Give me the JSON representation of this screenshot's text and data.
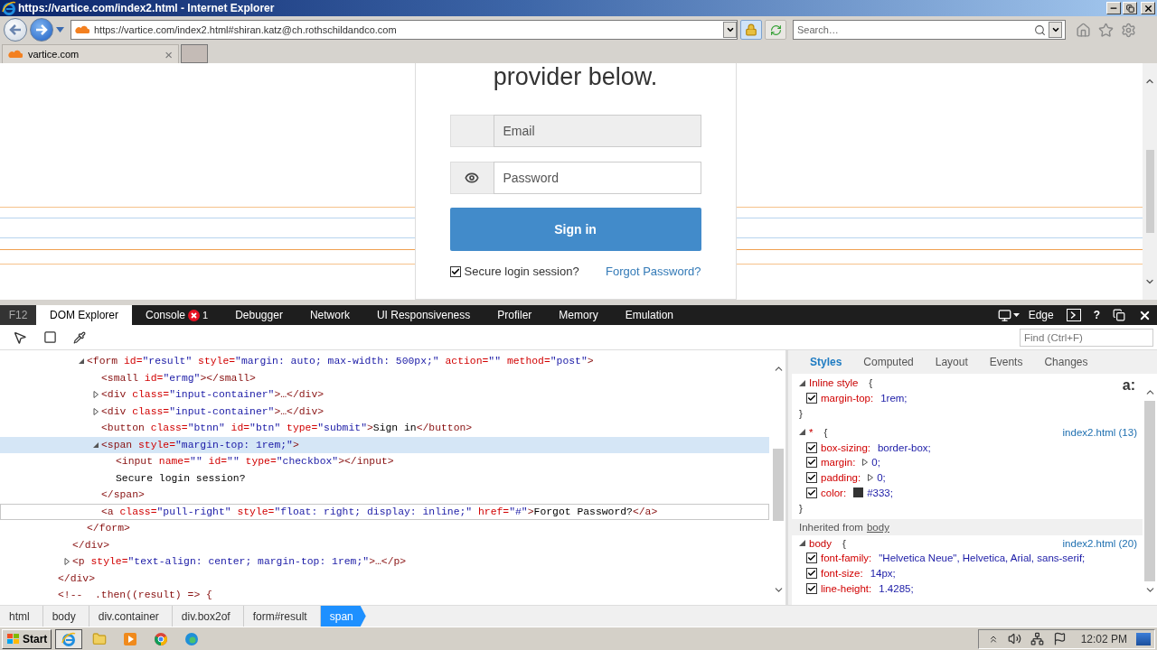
{
  "browser": {
    "title": "https://vartice.com/index2.html - Internet Explorer",
    "address": "https://vartice.com/index2.html#shiran.katz@ch.rothschildandco.com",
    "search": {
      "placeholder": "Search…"
    },
    "tabs": [
      {
        "label": "vartice.com",
        "close": "×",
        "selected": true
      }
    ]
  },
  "page": {
    "heading": "provider below.",
    "email": {
      "placeholder": "Email"
    },
    "password": {
      "placeholder": "Password"
    },
    "sign_in": "Sign in",
    "secure": {
      "label": "Secure login session?",
      "checked": true
    },
    "forgot": "Forgot Password?"
  },
  "devtools": {
    "f12": "F12",
    "tabs": [
      {
        "label": "DOM Explorer",
        "selected": true
      },
      {
        "label": "Console",
        "selected": false,
        "errors": "1"
      },
      {
        "label": "Debugger",
        "selected": false
      },
      {
        "label": "Network",
        "selected": false
      },
      {
        "label": "UI Responsiveness",
        "selected": false
      },
      {
        "label": "Profiler",
        "selected": false
      },
      {
        "label": "Memory",
        "selected": false
      },
      {
        "label": "Emulation",
        "selected": false
      }
    ],
    "mode": "Edge",
    "help": "?",
    "find": {
      "placeholder": "Find (Ctrl+F)"
    },
    "tree": [
      {
        "children": [
          {
            "children": [
              {
                "open": [
                  {
                    "kind": "tag",
                    "text": "<form "
                  },
                  {
                    "kind": "attr",
                    "text": "id="
                  },
                  {
                    "kind": "val",
                    "text": "\"result\" "
                  },
                  {
                    "kind": "attr",
                    "text": "style="
                  },
                  {
                    "kind": "val",
                    "text": "\"margin: auto; max-width: 500px;\" "
                  },
                  {
                    "kind": "attr",
                    "text": "action="
                  },
                  {
                    "kind": "val",
                    "text": "\"\" "
                  },
                  {
                    "kind": "attr",
                    "text": "method="
                  },
                  {
                    "kind": "val",
                    "text": "\"post\""
                  },
                  {
                    "kind": "tag",
                    "text": ">"
                  }
                ],
                "expanded": true,
                "selected": false,
                "hovered": false,
                "children": [
                  {
                    "open": [
                      {
                        "kind": "tag",
                        "text": "<small "
                      },
                      {
                        "kind": "attr",
                        "text": "id="
                      },
                      {
                        "kind": "val",
                        "text": "\"ermg\""
                      },
                      {
                        "kind": "tag",
                        "text": "></small>"
                      }
                    ],
                    "selected": false,
                    "hovered": false
                  },
                  {
                    "open": [
                      {
                        "kind": "tag",
                        "text": "<div "
                      },
                      {
                        "kind": "attr",
                        "text": "class="
                      },
                      {
                        "kind": "val",
                        "text": "\"input-container\""
                      },
                      {
                        "kind": "tag",
                        "text": ">…</div>"
                      }
                    ],
                    "expanded": false,
                    "selected": false,
                    "hovered": false
                  },
                  {
                    "open": [
                      {
                        "kind": "tag",
                        "text": "<div "
                      },
                      {
                        "kind": "attr",
                        "text": "class="
                      },
                      {
                        "kind": "val",
                        "text": "\"input-container\""
                      },
                      {
                        "kind": "tag",
                        "text": ">…</div>"
                      }
                    ],
                    "expanded": false,
                    "selected": false,
                    "hovered": false
                  },
                  {
                    "open": [
                      {
                        "kind": "tag",
                        "text": "<button "
                      },
                      {
                        "kind": "attr",
                        "text": "class="
                      },
                      {
                        "kind": "val",
                        "text": "\"btnn\" "
                      },
                      {
                        "kind": "attr",
                        "text": "id="
                      },
                      {
                        "kind": "val",
                        "text": "\"btn\" "
                      },
                      {
                        "kind": "attr",
                        "text": "type="
                      },
                      {
                        "kind": "val",
                        "text": "\"submit\""
                      },
                      {
                        "kind": "tag",
                        "text": ">"
                      },
                      {
                        "kind": "text",
                        "text": "Sign in"
                      },
                      {
                        "kind": "tag",
                        "text": "</button>"
                      }
                    ],
                    "selected": false,
                    "hovered": false
                  },
                  {
                    "open": [
                      {
                        "kind": "tag",
                        "text": "<span "
                      },
                      {
                        "kind": "attr",
                        "text": "style="
                      },
                      {
                        "kind": "val",
                        "text": "\"margin-top: 1rem;\""
                      },
                      {
                        "kind": "tag",
                        "text": ">"
                      }
                    ],
                    "expanded": true,
                    "selected": true,
                    "hovered": false,
                    "children": [
                      {
                        "open": [
                          {
                            "kind": "tag",
                            "text": "<input "
                          },
                          {
                            "kind": "attr",
                            "text": "name="
                          },
                          {
                            "kind": "val",
                            "text": "\"\" "
                          },
                          {
                            "kind": "attr",
                            "text": "id="
                          },
                          {
                            "kind": "val",
                            "text": "\"\" "
                          },
                          {
                            "kind": "attr",
                            "text": "type="
                          },
                          {
                            "kind": "val",
                            "text": "\"checkbox\""
                          },
                          {
                            "kind": "tag",
                            "text": "></input>"
                          }
                        ],
                        "selected": false,
                        "hovered": false
                      },
                      {
                        "open": [
                          {
                            "kind": "text",
                            "text": "Secure login session?"
                          }
                        ],
                        "selected": false,
                        "hovered": false
                      }
                    ],
                    "close": [
                      {
                        "kind": "tag",
                        "text": "</span>"
                      }
                    ]
                  },
                  {
                    "open": [
                      {
                        "kind": "tag",
                        "text": "<a "
                      },
                      {
                        "kind": "attr",
                        "text": "class="
                      },
                      {
                        "kind": "val",
                        "text": "\"pull-right\" "
                      },
                      {
                        "kind": "attr",
                        "text": "style="
                      },
                      {
                        "kind": "val",
                        "text": "\"float: right; display: inline;\" "
                      },
                      {
                        "kind": "attr",
                        "text": "href="
                      },
                      {
                        "kind": "val",
                        "text": "\"#\""
                      },
                      {
                        "kind": "tag",
                        "text": ">"
                      },
                      {
                        "kind": "text",
                        "text": "Forgot Password?"
                      },
                      {
                        "kind": "tag",
                        "text": "</a>"
                      }
                    ],
                    "selected": false,
                    "hovered": true
                  }
                ],
                "close": [
                  {
                    "kind": "tag",
                    "text": "</form>"
                  }
                ]
              }
            ],
            "close": [
              {
                "kind": "tag",
                "text": "</div>"
              }
            ]
          },
          {
            "open": [
              {
                "kind": "tag",
                "text": "<p "
              },
              {
                "kind": "attr",
                "text": "style="
              },
              {
                "kind": "val",
                "text": "\"text-align: center; margin-top: 1rem;\""
              },
              {
                "kind": "tag",
                "text": ">…</p>"
              }
            ],
            "expanded": false,
            "selected": false,
            "hovered": false
          }
        ],
        "close": [
          {
            "kind": "tag",
            "text": "</div>"
          }
        ]
      },
      {
        "open": [
          {
            "kind": "tag",
            "text": "<!--  .then((result) => {"
          }
        ],
        "selected": false,
        "hovered": false
      }
    ],
    "breadcrumb": [
      {
        "label": "html",
        "selected": false
      },
      {
        "label": "body",
        "selected": false
      },
      {
        "label": "div.container",
        "selected": false
      },
      {
        "label": "div.box2of",
        "selected": false
      },
      {
        "label": "form#result",
        "selected": false
      },
      {
        "label": "span",
        "selected": true
      }
    ],
    "styles": {
      "tabs": [
        {
          "label": "Styles",
          "selected": true
        },
        {
          "label": "Computed",
          "selected": false
        },
        {
          "label": "Layout",
          "selected": false
        },
        {
          "label": "Events",
          "selected": false
        },
        {
          "label": "Changes",
          "selected": false
        }
      ],
      "toggle": "a:",
      "rules": [
        {
          "kind": "rule",
          "selector": "Inline style",
          "open_brace": "{",
          "close_brace": "}",
          "props": [
            {
              "name": "margin-top:",
              "value": "1rem;",
              "checked": true
            }
          ]
        },
        {
          "kind": "rule",
          "selector": "*",
          "open_brace": "{",
          "close_brace": "}",
          "source": "index2.html (13)",
          "props": [
            {
              "name": "box-sizing:",
              "value": "border-box;",
              "checked": true
            },
            {
              "name": "margin:",
              "value": "0;",
              "checked": true,
              "expandable": true
            },
            {
              "name": "padding:",
              "value": "0;",
              "checked": true,
              "expandable": true
            },
            {
              "name": "color:",
              "value": "#333;",
              "checked": true,
              "color": "#333333"
            }
          ]
        },
        {
          "kind": "inherited",
          "label": "Inherited from",
          "link": "body"
        },
        {
          "kind": "rule",
          "selector": "body",
          "open_brace": "{",
          "source": "index2.html (20)",
          "props": [
            {
              "name": "font-family:",
              "value": "\"Helvetica Neue\", Helvetica, Arial, sans-serif;",
              "checked": true
            },
            {
              "name": "font-size:",
              "value": "14px;",
              "checked": true
            },
            {
              "name": "line-height:",
              "value": "1.4285;",
              "checked": true
            }
          ]
        }
      ]
    }
  },
  "taskbar": {
    "start": "Start",
    "clock": "12:02 PM"
  }
}
